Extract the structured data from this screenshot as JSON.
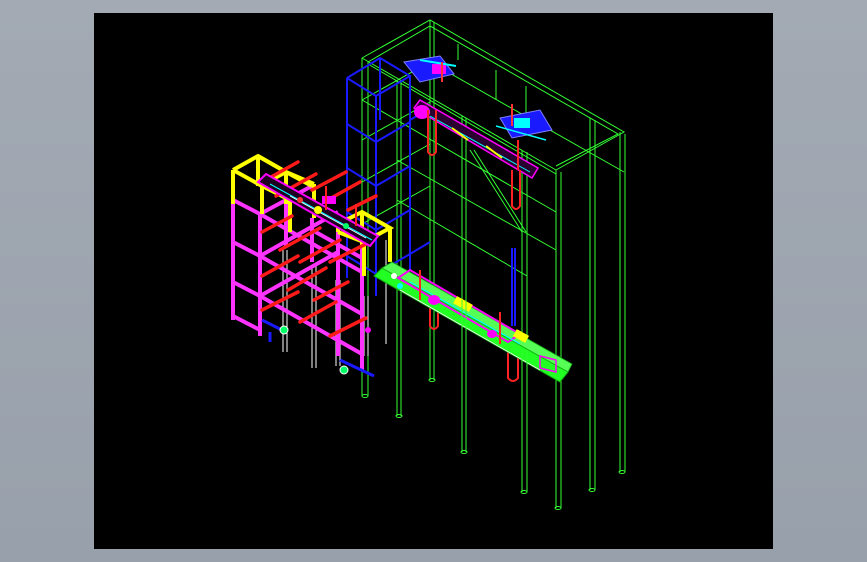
{
  "viewport": {
    "background": "#000000",
    "page_background": "#9ea6b0"
  },
  "drawing": {
    "style": "wireframe",
    "colors": {
      "structure_frame": "#33ff33",
      "support_tower": "#1a1aff",
      "rack_upper": "#ffff00",
      "rack_lower": "#ff33ff",
      "crossbars": "#ff1a1a",
      "conveyor_beam": "#22ff22",
      "hangers": "#ff2222",
      "detail_parts": "#ff00ff",
      "guide_rails": "#ffffff"
    }
  }
}
